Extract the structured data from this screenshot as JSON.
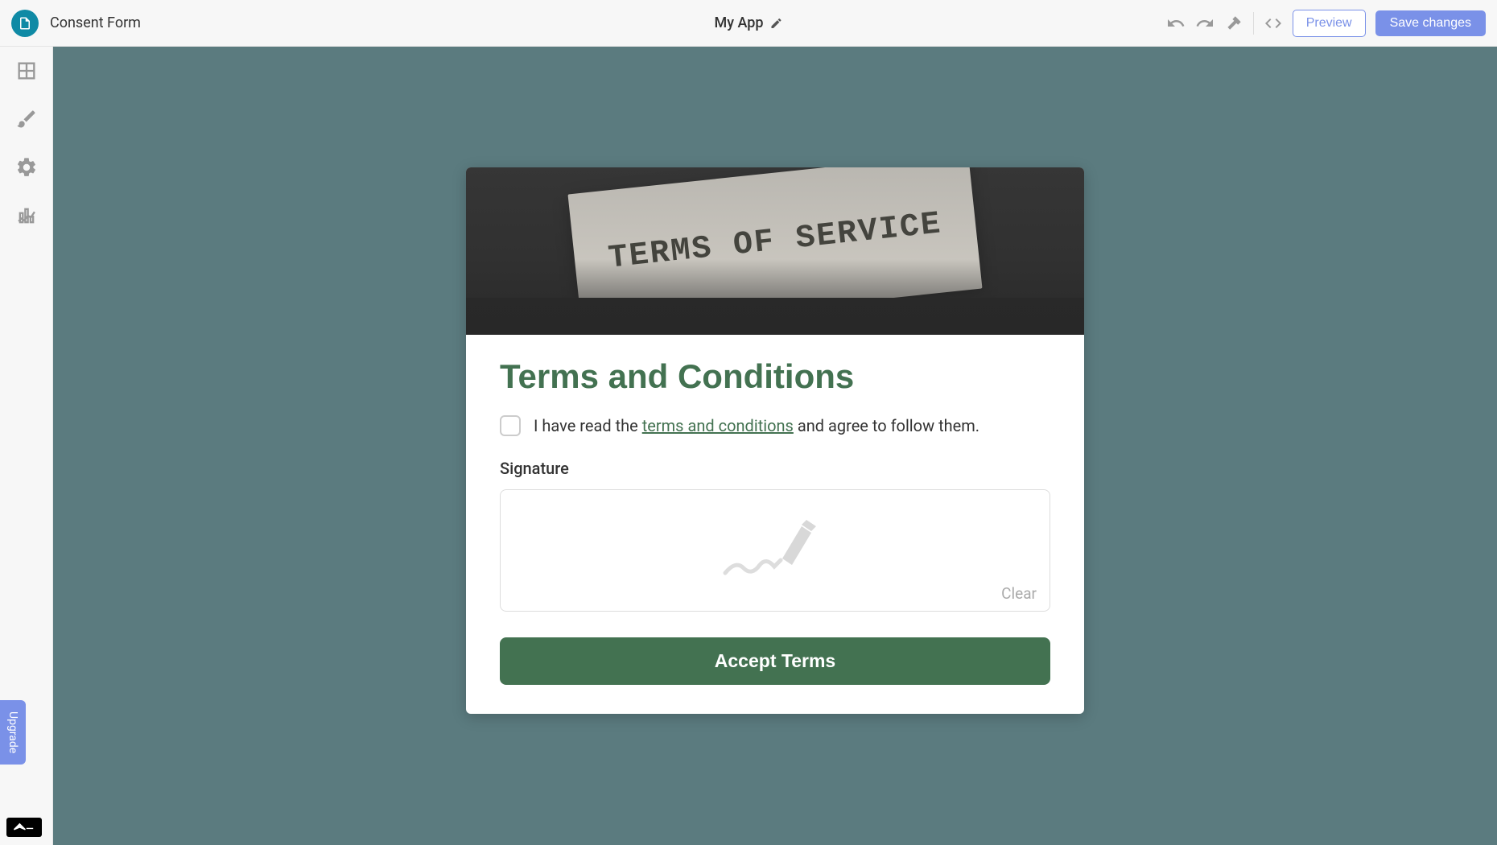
{
  "topbar": {
    "page_title": "Consent Form",
    "app_name": "My App",
    "preview_label": "Preview",
    "save_label": "Save changes"
  },
  "leftbar": {
    "upgrade_label": "Upgrade"
  },
  "card": {
    "hero_text": "TERMS OF SERVICE",
    "heading": "Terms and Conditions",
    "consent_prefix": "I have read the ",
    "consent_link": "terms and conditions",
    "consent_suffix": " and agree to follow them.",
    "signature_label": "Signature",
    "clear_label": "Clear",
    "accept_label": "Accept Terms"
  }
}
